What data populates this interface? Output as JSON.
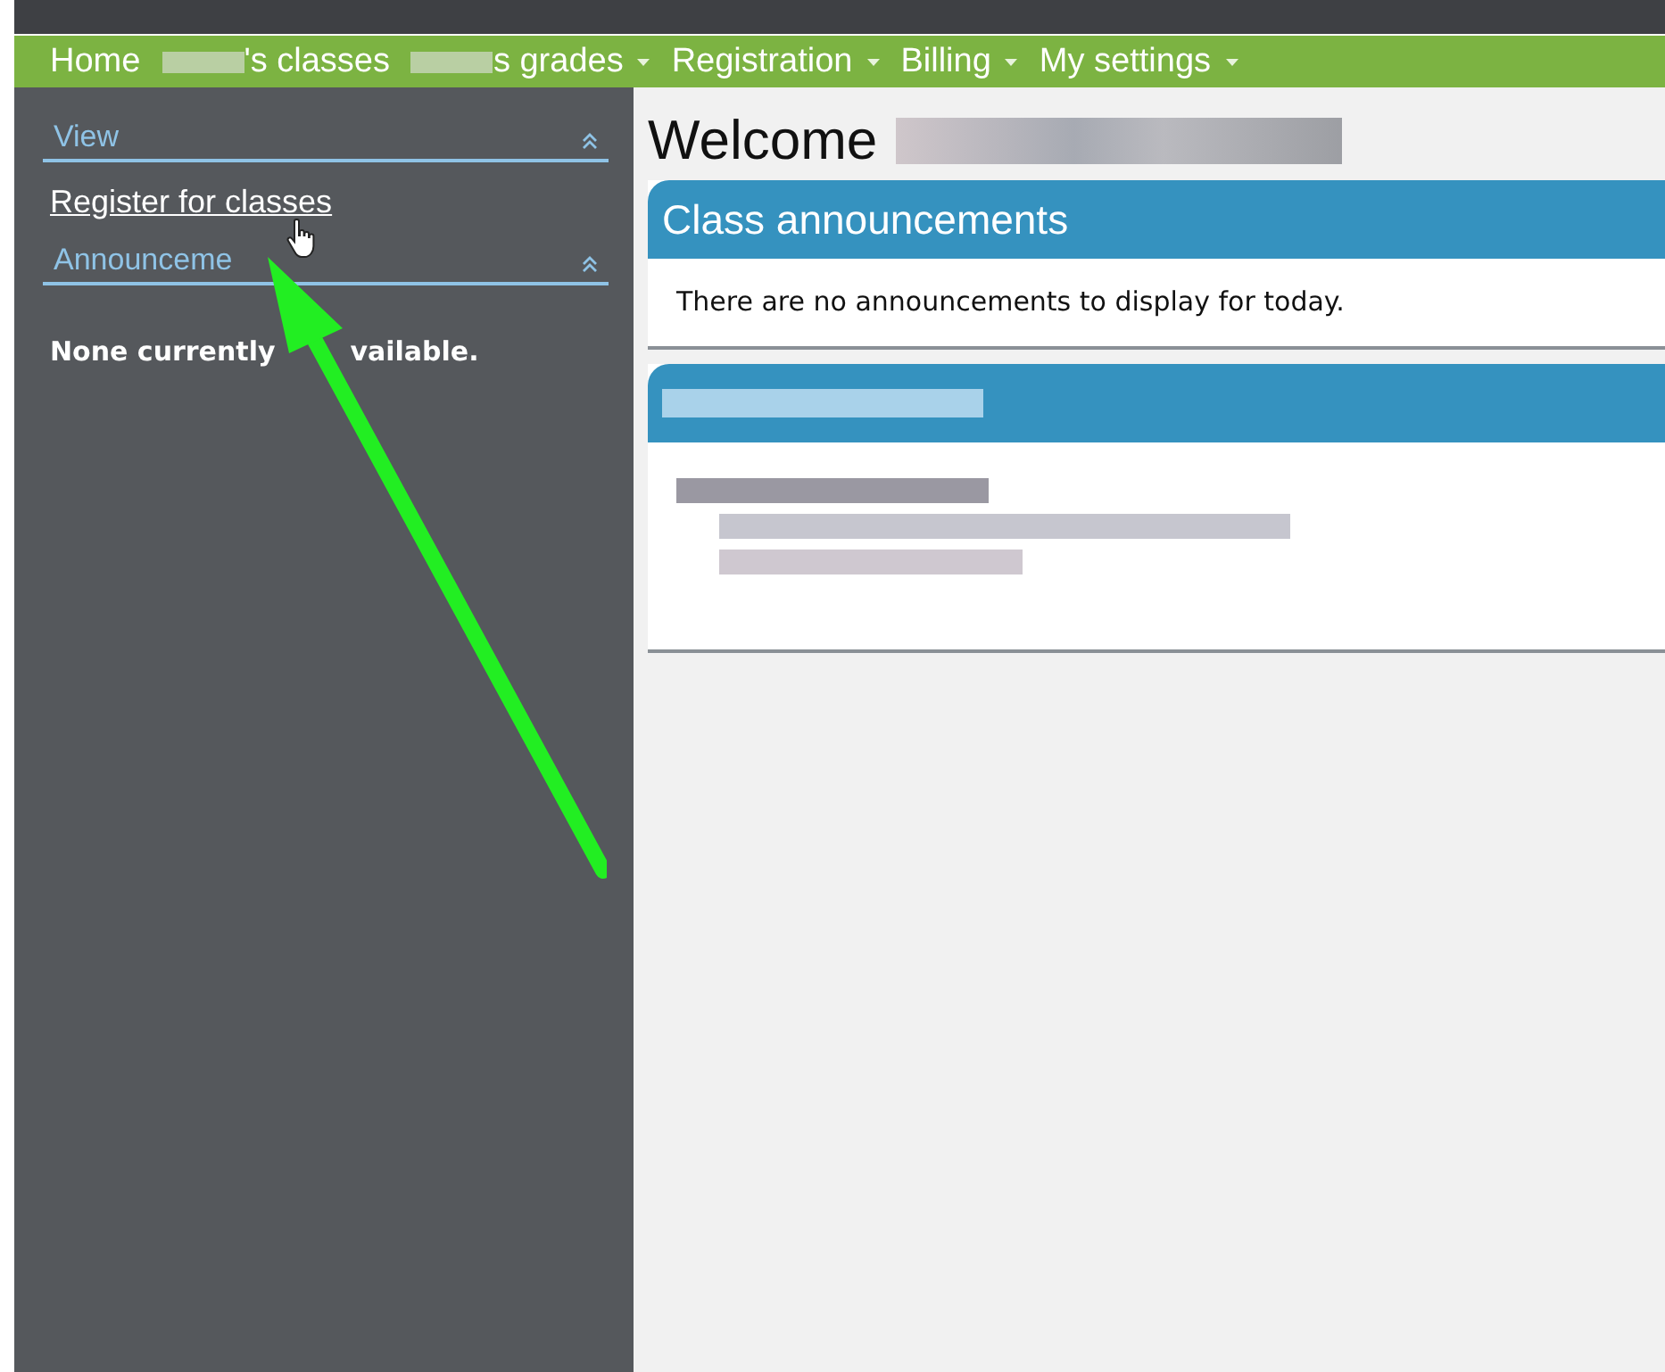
{
  "nav": [
    {
      "label": "Home",
      "redacted_before": false,
      "dropdown": false
    },
    {
      "label": "'s classes",
      "redacted_before": true,
      "dropdown": false
    },
    {
      "label": "s grades",
      "redacted_before": true,
      "dropdown": true
    },
    {
      "label": "Registration",
      "redacted_before": false,
      "dropdown": true
    },
    {
      "label": "Billing",
      "redacted_before": false,
      "dropdown": true
    },
    {
      "label": "My settings",
      "redacted_before": false,
      "dropdown": true
    }
  ],
  "sidebar": {
    "sections": [
      {
        "title": "View",
        "expanded": true,
        "kind": "links",
        "links": [
          "Register for classes"
        ]
      },
      {
        "title": "Announceme",
        "expanded": true,
        "kind": "note",
        "note_parts": [
          "None currently",
          "vailable."
        ]
      }
    ]
  },
  "welcome": {
    "text": "Welcome",
    "name_redacted": true
  },
  "panels": [
    {
      "kind": "text",
      "title": "Class announcements",
      "body": "There are no announcements to display for today."
    },
    {
      "kind": "redacted"
    }
  ]
}
